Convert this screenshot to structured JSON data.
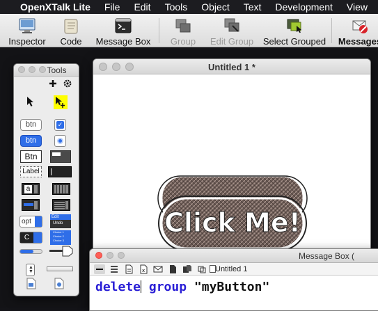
{
  "menubar": {
    "app_name": "OpenXTalk Lite",
    "items": [
      "File",
      "Edit",
      "Tools",
      "Object",
      "Text",
      "Development",
      "View"
    ]
  },
  "toolbar": {
    "buttons": [
      {
        "label": "Inspector",
        "icon": "inspector-icon",
        "enabled": true
      },
      {
        "label": "Code",
        "icon": "script-scroll-icon",
        "enabled": true
      },
      {
        "label": "Message Box",
        "icon": "terminal-icon",
        "enabled": true
      },
      {
        "label": "Group",
        "icon": "group-icon",
        "enabled": false
      },
      {
        "label": "Edit Group",
        "icon": "edit-group-icon",
        "enabled": false
      },
      {
        "label": "Select Grouped",
        "icon": "select-grouped-icon",
        "enabled": true
      },
      {
        "label": "Messages",
        "icon": "messages-off-icon",
        "enabled": true
      }
    ]
  },
  "tools_palette": {
    "title": "Tools",
    "widgets": {
      "btn": "btn",
      "btn_blue": "btn",
      "btn_square": "Btn",
      "label": "Label",
      "field_a": "a",
      "option": "opt",
      "combo": "C",
      "menu_edit": "Edit",
      "menu_undo": "Undo",
      "choices": [
        "Choice 1",
        "Choice 2",
        "Choice 3"
      ]
    }
  },
  "stack_window": {
    "title": "Untitled 1 *",
    "button_label": "Click Me!"
  },
  "message_box": {
    "title": "Message Box (",
    "stack_name": "Untitled 1",
    "command": {
      "kw1": "delete",
      "kw2": "group",
      "string": "\"myButton\""
    }
  },
  "colors": {
    "keyword": "#2a1fd6",
    "selected_tool": "#ffff00",
    "accent_blue": "#2f6ee8"
  }
}
